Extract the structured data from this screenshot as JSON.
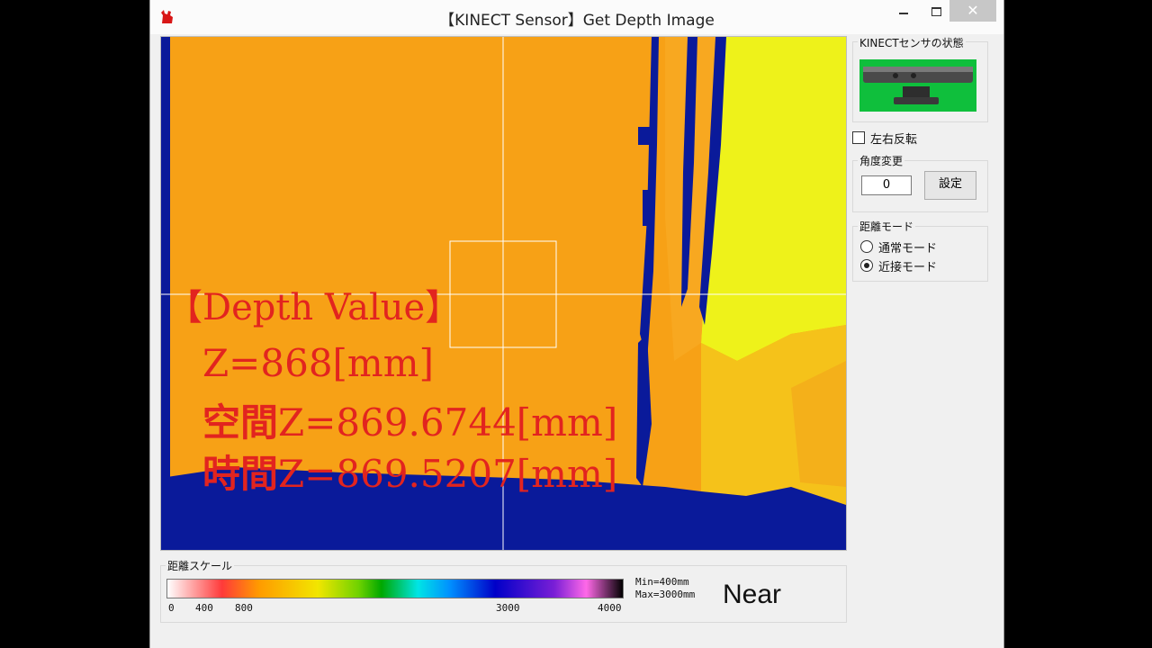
{
  "window": {
    "title": "【KINECT Sensor】Get Depth Image",
    "close_glyph": "✕"
  },
  "depth_view": {
    "heading": "【Depth Value】",
    "z_line": "Z=868[mm]",
    "spatial_line_prefix": "空間",
    "spatial_line_value": "Z=869.6744[mm]",
    "temporal_line_prefix": "時間",
    "temporal_line_value": "Z=869.5207[mm]",
    "text_color": "#e2241f"
  },
  "sidebar": {
    "sensor_status_label": "KINECTセンサの状態",
    "mirror_label": "左右反転",
    "mirror_checked": false,
    "angle_group_label": "角度変更",
    "angle_value": "0",
    "set_button_label": "設定",
    "range_group_label": "距離モード",
    "range_options": [
      {
        "label": "通常モード",
        "selected": false
      },
      {
        "label": "近接モード",
        "selected": true
      }
    ]
  },
  "scale": {
    "group_label": "距離スケール",
    "ticks": [
      "0",
      "400",
      "800",
      "3000",
      "4000"
    ],
    "min_text": "Min=400mm",
    "max_text": "Max=3000mm",
    "mode_text": "Near"
  },
  "colors": {
    "orange": "#f7a116",
    "blue_void": "#0a1a9a",
    "yellow": "#eef21a",
    "sensor_green": "#0fbf3c"
  }
}
